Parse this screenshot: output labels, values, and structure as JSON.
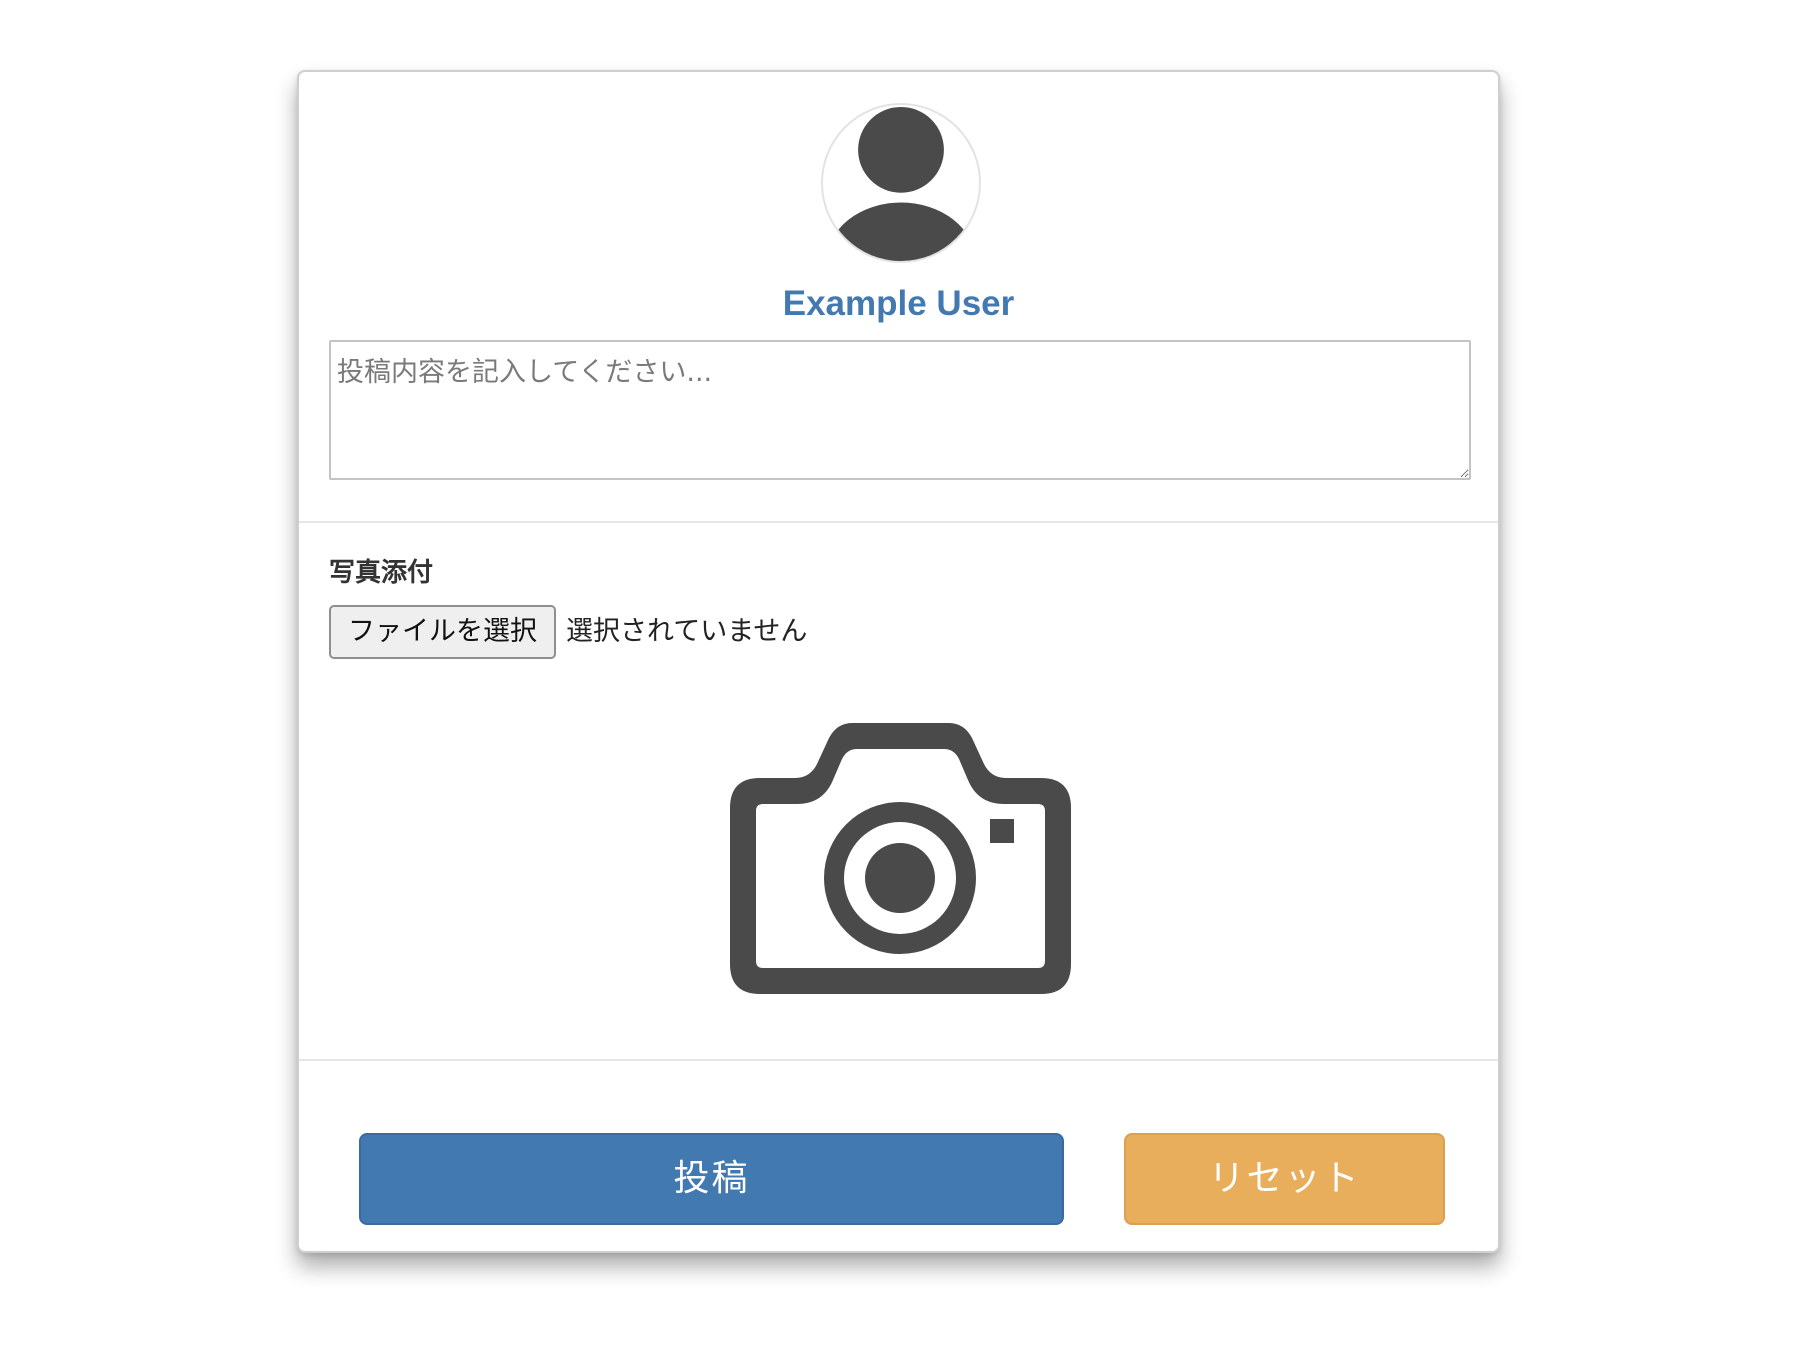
{
  "user": {
    "name": "Example User",
    "avatar_icon": "user-silhouette-icon"
  },
  "post": {
    "placeholder": "投稿内容を記入してください...",
    "value": ""
  },
  "attachment": {
    "label": "写真添付",
    "choose_button_label": "ファイルを選択",
    "status_text": "選択されていません",
    "preview_icon": "camera-icon"
  },
  "actions": {
    "post_label": "投稿",
    "reset_label": "リセット"
  },
  "colors": {
    "accent_blue": "#4379b1",
    "reset_orange": "#e8ae5c",
    "icon_gray": "#4a4a4a"
  }
}
